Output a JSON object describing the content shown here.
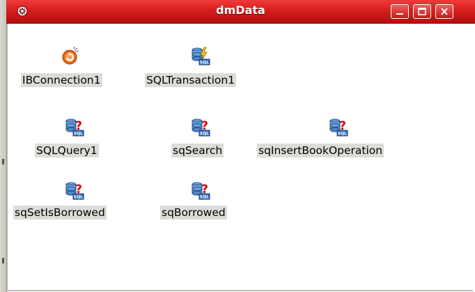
{
  "window": {
    "title": "dmData"
  },
  "components": [
    {
      "label": "IBConnection1",
      "icon": "ib-connection-icon"
    },
    {
      "label": "SQLTransaction1",
      "icon": "sql-transaction-icon"
    },
    {
      "label": "SQLQuery1",
      "icon": "sql-query-icon"
    },
    {
      "label": "sqSearch",
      "icon": "sql-query-icon"
    },
    {
      "label": "sqInsertBookOperation",
      "icon": "sql-query-icon"
    },
    {
      "label": "sqSetIsBorrowed",
      "icon": "sql-query-icon"
    },
    {
      "label": "sqBorrowed",
      "icon": "sql-query-icon"
    }
  ],
  "colors": {
    "titlebar": "#d61e1e",
    "label_bg": "#dedcd6"
  }
}
